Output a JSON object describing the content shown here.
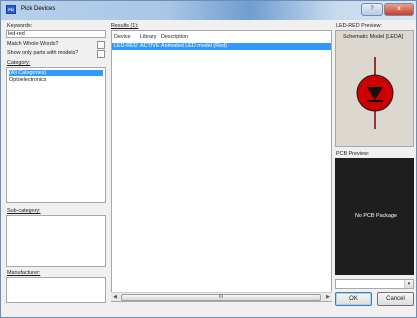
{
  "window": {
    "title": "Pick Devices",
    "icon": "pick-devices-app-icon",
    "help_label": "?",
    "close_label": "x"
  },
  "left": {
    "keywords_label": "Keywords:",
    "keywords_value": "led-red",
    "match_whole_words_label": "Match Whole Words?",
    "show_only_models_label": "Show only parts with models?",
    "category_label": "Category:",
    "categories": [
      "(All Categories)",
      "Optoelectronics"
    ],
    "subcategory_label": "Sub-category:",
    "manufacturer_label": "Manufacturer:"
  },
  "results": {
    "label": "Results (1):",
    "columns": [
      "Device",
      "Library",
      "Description"
    ],
    "rows": [
      {
        "device": "LED-RED",
        "library": "ACTIVE",
        "description": "Animated LED model (Red)"
      }
    ],
    "scroll_thumb": "III"
  },
  "preview": {
    "title": "LED-RED Preview:",
    "schematic_label": "Schematic Model [LEDA]",
    "led_color": "#cc0000",
    "pcb_label": "PCB Preview:",
    "pcb_message": "No PCB Package"
  },
  "buttons": {
    "ok": "OK",
    "cancel": "Cancel"
  },
  "combo_arrow": "▾"
}
